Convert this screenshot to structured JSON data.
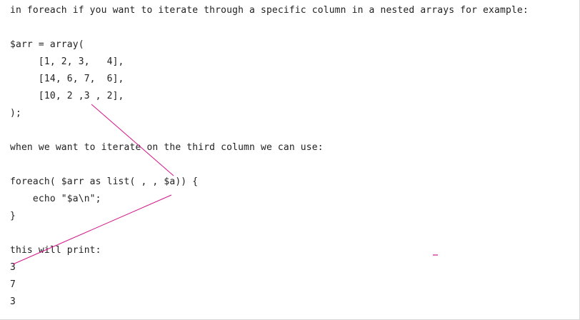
{
  "content": {
    "lines": [
      "in foreach if you want to iterate through a specific column in a nested arrays for example:",
      "$arr = array(",
      "     [1, 2, 3,   4],",
      "     [14, 6, 7,  6],",
      "     [10, 2 ,3 , 2],",
      ");",
      "when we want to iterate on the third column we can use:",
      "foreach( $arr as list( , , $a)) {",
      "    echo \"$a\\n\";",
      "}",
      "this will print:",
      "3",
      "7",
      "3"
    ]
  },
  "annotations": {
    "stroke_color": "#d4148a"
  }
}
